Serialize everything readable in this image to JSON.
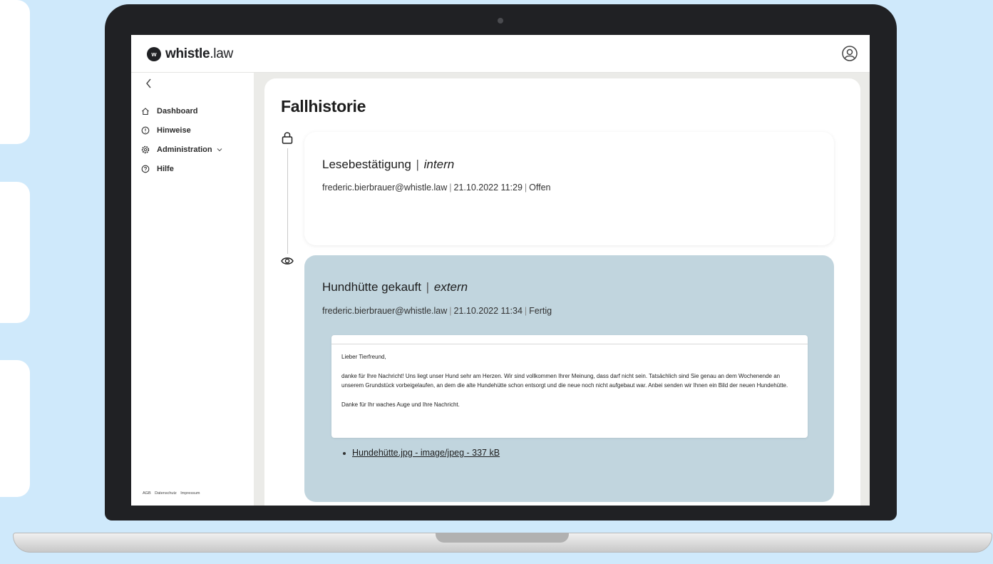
{
  "app": {
    "brand_bold": "whistle",
    "brand_light": ".law",
    "logo_mark": "w"
  },
  "sidebar": {
    "items": [
      {
        "label": "Dashboard",
        "icon": "home-icon"
      },
      {
        "label": "Hinweise",
        "icon": "info-icon"
      },
      {
        "label": "Administration",
        "icon": "gear-icon"
      },
      {
        "label": "Hilfe",
        "icon": "help-icon"
      }
    ],
    "footer": [
      "AGB",
      "Datenschutz",
      "Impressum"
    ]
  },
  "page": {
    "title": "Fallhistorie"
  },
  "entries": [
    {
      "title": "Lesebestätigung",
      "visibility": "intern",
      "author": "frederic.bierbrauer@whistle.law",
      "date": "21.10.2022 11:29",
      "status": "Offen",
      "icon": "lock-icon"
    },
    {
      "title": "Hundhütte gekauft",
      "visibility": "extern",
      "author": "frederic.bierbrauer@whistle.law",
      "date": "21.10.2022 11:34",
      "status": "Fertig",
      "icon": "eye-icon",
      "message": {
        "greeting": "Lieber Tierfreund,",
        "body": "danke für Ihre Nachricht! Uns liegt unser Hund sehr am Herzen. Wir sind vollkommen Ihrer Meinung, dass darf nicht sein. Tatsächlich sind Sie genau an dem Wochenende an unserem Grundstück vorbeigelaufen, an dem die alte Hundehütte schon entsorgt und die neue noch nicht aufgebaut war. Anbei senden wir Ihnen ein Bild der neuen Hundehütte.",
        "closing": "Danke für Ihr waches Auge und Ihre Nachricht."
      },
      "attachment": "Hundehütte.jpg - image/jpeg - 337 kB"
    }
  ],
  "colors": {
    "background": "#cfe9fb",
    "external_entry": "#c1d5de",
    "laptop": "#202124"
  }
}
